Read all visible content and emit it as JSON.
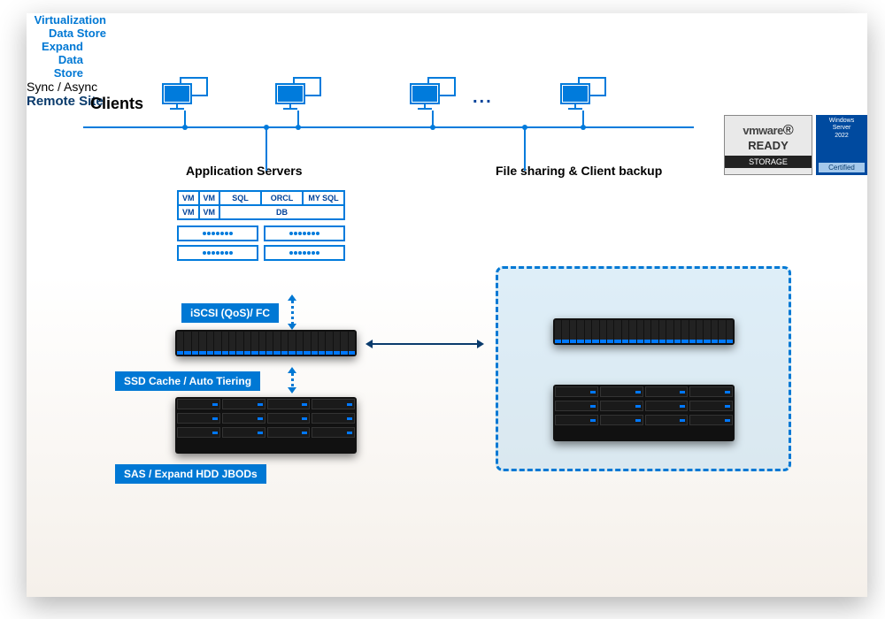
{
  "labels": {
    "clients": "Clients",
    "app_servers": "Application Servers",
    "file_sharing": "File sharing & Client backup",
    "ellipsis": "...",
    "virtualization": {
      "l1": "Virtualization",
      "l2": "Data Store"
    },
    "expand": {
      "l1": "Expand",
      "l2": "Data Store"
    },
    "remote_site": "Remote Site",
    "sync_async": "Sync / Async"
  },
  "badges": {
    "iscsi": "iSCSI (QoS)/ FC",
    "ssd": "SSD Cache / Auto Tiering",
    "sas": "SAS / Expand HDD JBODs"
  },
  "apptable": {
    "row1": [
      "VM",
      "VM",
      "SQL",
      "ORCL",
      "MY SQL"
    ],
    "row2_vm": [
      "VM",
      "VM"
    ],
    "row2_db": "DB"
  },
  "cert": {
    "vmware_logo": "vmware",
    "vmware_reg": "®",
    "vmware_ready": "READY",
    "vmware_storage": "STORAGE",
    "ws_top_l1": "Windows",
    "ws_top_l2": "Server",
    "ws_top_l3": "2022",
    "ws_bot": "Certified"
  },
  "colors": {
    "primary": "#0078d4",
    "line": "#007bdc",
    "dark": "#0a3b6c"
  }
}
